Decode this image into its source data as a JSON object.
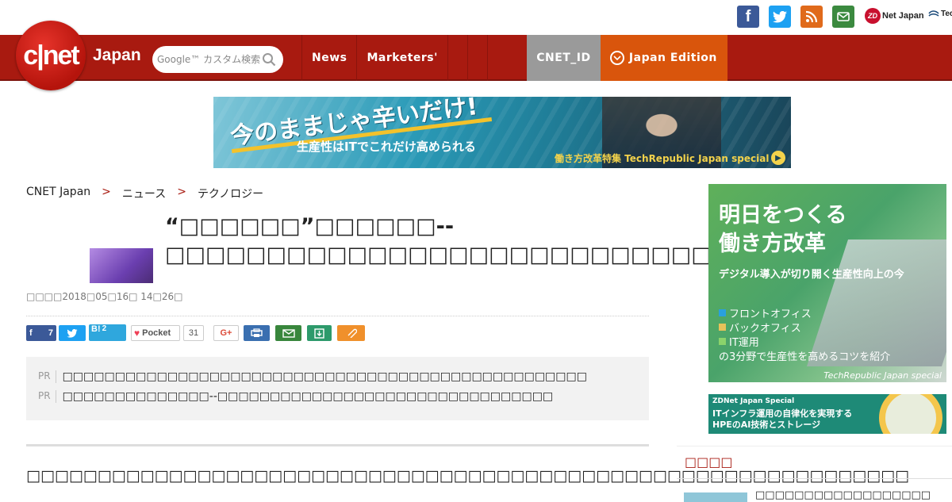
{
  "top": {
    "facebook_label": "f",
    "zdnet_label": "Net Japan",
    "zdnet_badge": "ZD",
    "techrepublic_label": "Tec"
  },
  "nav": {
    "logo_text": "c|net",
    "logo_sub": "Japan",
    "search_placeholder": "Google™ カスタム検索",
    "items": [
      "News",
      "Marketers'"
    ],
    "cnet_id": "CNET_ID",
    "edition": "Japan Edition"
  },
  "banner": {
    "headline": "今のままじゃ辛いだけ!",
    "subline": "生産性はITでこれだけ高められる",
    "special": "働き方改革特集 TechRepublic Japan special"
  },
  "breadcrumb": [
    "CNET Japan",
    "ニュース",
    "テクノロジー"
  ],
  "breadcrumb_sep": ">",
  "article": {
    "title": "“□□□□□□”□□□□□□--□□□□□□□□□□□□□□□□□□□□□□□□□□□□□□",
    "date": "□□□□2018□05□16□ 14□26□",
    "share": {
      "fb_count": "7",
      "hatena": "B!",
      "hatena_count": "2",
      "pocket": "Pocket",
      "pocket_count": "31",
      "gplus": "G+"
    },
    "pr_tag": "PR",
    "pr_items": [
      "□□□□□□□□□□□□□□□□□□□□□□□□□□□□□□□□□□□□□□□□□□□□□□□□□□",
      "□□□□□□□□□□□□□□--□□□□□□□□□□□□□□□□□□□□□□□□□□□□□□□□"
    ],
    "lead": "□□□□□□□□□□□□□□□□□□□□□□□□□□□□□□□□□□□□□□□□□□□□□□□□□□□□□□□□□□□□□□"
  },
  "sidebar": {
    "ad1": {
      "headline_1": "明日をつくる",
      "headline_2": "働き方改革",
      "sub": "デジタル導入が切り開く生産性向上の今",
      "items": [
        "フロントオフィス",
        "バックオフィス",
        "IT運用"
      ],
      "item_colors": [
        "#2aa0dd",
        "#e8c25a",
        "#8bd36b"
      ],
      "tail": "の3分野で生産性を高めるコツを紹介",
      "footer": "TechRepublic Japan special"
    },
    "ad2": {
      "label": "ZDNet Japan Special",
      "line1": "ITインフラ運用の自律化を実現する",
      "line2": "HPEのAI技術とストレージ"
    },
    "section_title": "□□□□",
    "first_item": "□□□□□□□□□□□□□□□□□□"
  },
  "colors": {
    "brand_red": "#a81a10",
    "edition_orange": "#d9550c",
    "cnet_id_gray": "#9a9a9a"
  }
}
